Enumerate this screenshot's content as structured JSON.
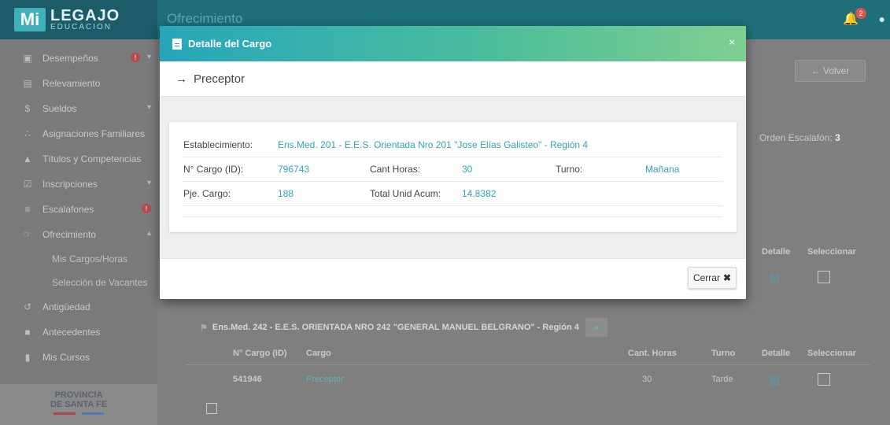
{
  "app": {
    "logo_mark": "Mi",
    "logo_line1": "LEGAJO",
    "logo_line2": "EDUCACION",
    "page_title": "Ofrecimiento",
    "notification_count": "2"
  },
  "sidebar": {
    "items": [
      {
        "label": "Desempeños",
        "icon": "briefcase-icon",
        "badge": "!",
        "chevron": true
      },
      {
        "label": "Relevamiento",
        "icon": "document-icon"
      },
      {
        "label": "Sueldos",
        "icon": "dollar-icon",
        "chevron": true
      },
      {
        "label": "Asignaciones Familiares",
        "icon": "family-icon"
      },
      {
        "label": "Títulos y Competencias",
        "icon": "graduation-cap-icon"
      },
      {
        "label": "Inscripciones",
        "icon": "checkbox-icon",
        "chevron": true
      },
      {
        "label": "Escalafones",
        "icon": "list-icon",
        "badge": "!"
      },
      {
        "label": "Ofrecimiento",
        "icon": "offer-icon",
        "chevron": true
      }
    ],
    "subitems": [
      "Mis Cargos/Horas",
      "Selección de Vacantes"
    ],
    "items_after": [
      {
        "label": "Antigüedad",
        "icon": "history-icon"
      },
      {
        "label": "Antecedentes",
        "icon": "folder-icon"
      },
      {
        "label": "Mis Cursos",
        "icon": "course-icon"
      }
    ],
    "footer_line1": "PROVINCIA",
    "footer_line2": "DE SANTA FE"
  },
  "background": {
    "volver_label": "← Volver",
    "orden_label": "Orden Escalafón:",
    "orden_value": "3",
    "table1_headers": {
      "detalle": "Detalle",
      "seleccionar": "Seleccionar"
    },
    "establishment2": "Ens.Med. 242 - E.E.S. ORIENTADA NRO 242 \"GENERAL MANUEL BELGRANO\" - Región 4",
    "table2_headers": {
      "cargo_id": "N° Cargo (ID)",
      "cargo": "Cargo",
      "cant_horas": "Cant. Horas",
      "turno": "Turno",
      "detalle": "Detalle",
      "seleccionar": "Seleccionar"
    },
    "table2_row": {
      "cargo_id": "541946",
      "cargo": "Preceptor",
      "cant_horas": "30",
      "turno": "Tarde"
    }
  },
  "modal": {
    "title": "Detalle del Cargo",
    "close_symbol": "×",
    "subtitle": "Preceptor",
    "fields": {
      "establecimiento_label": "Establecimiento:",
      "establecimiento_value": "Ens.Med. 201 - E.E.S. Orientada Nro 201 \"Jose Elías Galisteo\" - Región 4",
      "cargo_id_label": "N° Cargo (ID):",
      "cargo_id_value": "796743",
      "cant_horas_label": "Cant Horas:",
      "cant_horas_value": "30",
      "turno_label": "Turno:",
      "turno_value": "Mañana",
      "pje_label": "Pje. Cargo:",
      "pje_value": "188",
      "total_label": "Total Unid Acum:",
      "total_value": "14.8382"
    },
    "close_button": "Cerrar"
  },
  "colors": {
    "accent": "#2fa6b8",
    "header_gradient_start": "#27a6bb",
    "header_gradient_end": "#7fcf8f",
    "badge_red": "#d9534f"
  }
}
